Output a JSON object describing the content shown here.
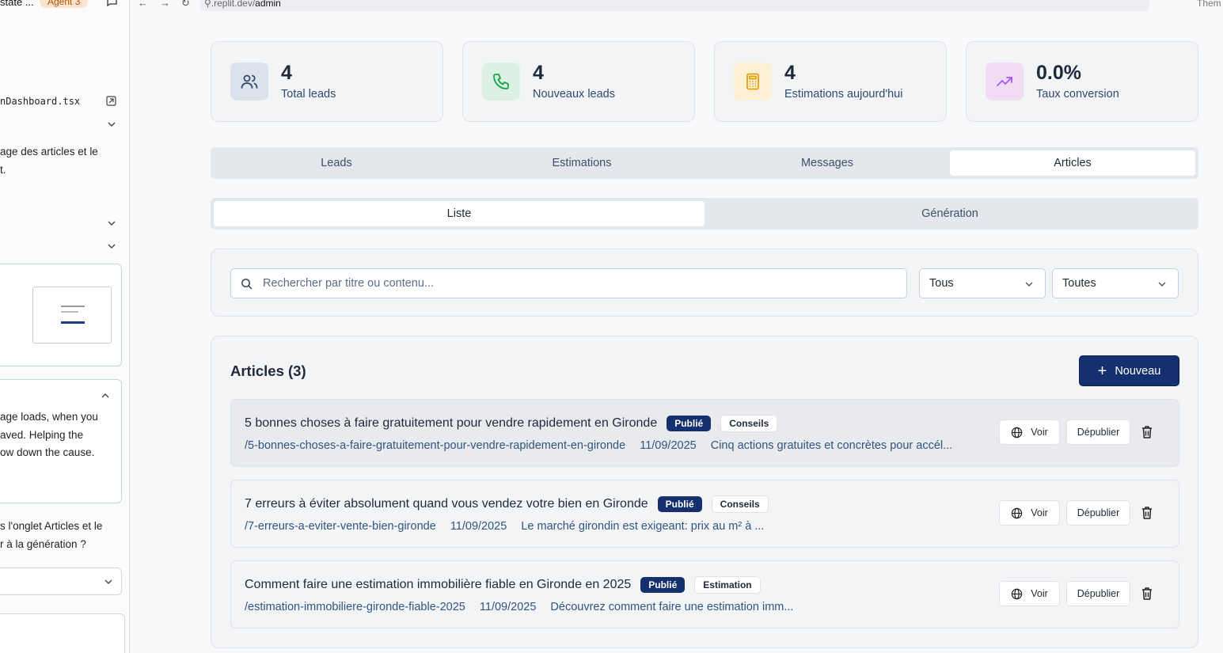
{
  "left_panel": {
    "title_fragment": "state ...",
    "agent_badge": "Agent 3",
    "file_name": "nDashboard.tsx",
    "text_block_1": [
      "age des articles et le",
      "t."
    ],
    "text_block_2": [
      "age loads, when you",
      "aved. Helping the",
      "ow down the cause."
    ],
    "text_block_3": [
      "s l'onglet Articles et le",
      "r à la génération ?"
    ]
  },
  "browser": {
    "url_prefix": ".replit.dev/",
    "url_path": "admin",
    "theme_label": "Them"
  },
  "stats": [
    {
      "value": "4",
      "label": "Total leads",
      "icon": "users-icon",
      "bg": "#dde3ec",
      "color": "#2f4a6e"
    },
    {
      "value": "4",
      "label": "Nouveaux leads",
      "icon": "phone-icon",
      "bg": "#dcf1e3",
      "color": "#16a34a"
    },
    {
      "value": "4",
      "label": "Estimations aujourd'hui",
      "icon": "calculator-icon",
      "bg": "#fbefd4",
      "color": "#e3a008"
    },
    {
      "value": "0.0%",
      "label": "Taux conversion",
      "icon": "trending-up-icon",
      "bg": "#f0ddf3",
      "color": "#a855f7"
    }
  ],
  "tabs": [
    {
      "label": "Leads",
      "active": false
    },
    {
      "label": "Estimations",
      "active": false
    },
    {
      "label": "Messages",
      "active": false
    },
    {
      "label": "Articles",
      "active": true
    }
  ],
  "subtabs": [
    {
      "label": "Liste",
      "active": true
    },
    {
      "label": "Génération",
      "active": false
    }
  ],
  "filters": {
    "search_placeholder": "Rechercher par titre ou contenu...",
    "status_select": "Tous",
    "category_select": "Toutes"
  },
  "articles": {
    "heading": "Articles (3)",
    "new_button": "Nouveau",
    "voir_label": "Voir",
    "depublier_label": "Dépublier",
    "items": [
      {
        "title": "5 bonnes choses à faire gratuitement pour vendre rapidement en Gironde",
        "status": "Publié",
        "category": "Conseils",
        "slug": "/5-bonnes-choses-a-faire-gratuitement-pour-vendre-rapidement-en-gironde",
        "date": "11/09/2025",
        "excerpt": "Cinq actions gratuites et concrètes pour accél..."
      },
      {
        "title": "7 erreurs à éviter absolument quand vous vendez votre bien en Gironde",
        "status": "Publié",
        "category": "Conseils",
        "slug": "/7-erreurs-a-eviter-vente-bien-gironde",
        "date": "11/09/2025",
        "excerpt": "Le marché girondin est exigeant: prix au m² à ..."
      },
      {
        "title": "Comment faire une estimation immobilière fiable en Gironde en 2025",
        "status": "Publié",
        "category": "Estimation",
        "slug": "/estimation-immobiliere-gironde-fiable-2025",
        "date": "11/09/2025",
        "excerpt": "Découvrez comment faire une estimation imm..."
      }
    ]
  }
}
